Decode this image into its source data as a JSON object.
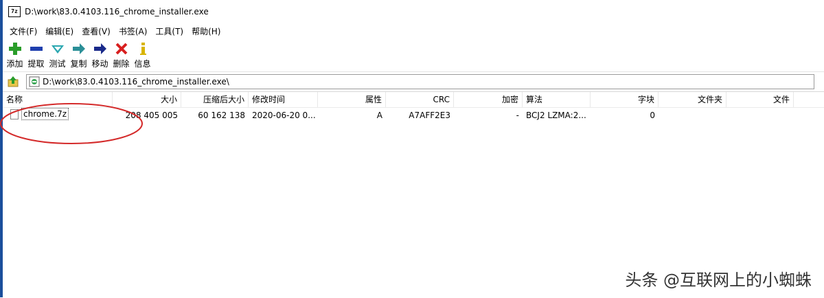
{
  "window": {
    "title": "D:\\work\\83.0.4103.116_chrome_installer.exe",
    "app_icon_text": "7z"
  },
  "menu": [
    "文件(F)",
    "编辑(E)",
    "查看(V)",
    "书签(A)",
    "工具(T)",
    "帮助(H)"
  ],
  "toolbar": {
    "add": "添加",
    "extract": "提取",
    "test": "测试",
    "copy": "复制",
    "move": "移动",
    "delete": "删除",
    "info": "信息"
  },
  "address": {
    "path": "D:\\work\\83.0.4103.116_chrome_installer.exe\\"
  },
  "columns": {
    "name": "名称",
    "size": "大小",
    "packed": "压缩后大小",
    "modified": "修改时间",
    "attributes": "属性",
    "crc": "CRC",
    "encrypted": "加密",
    "method": "算法",
    "block": "字块",
    "folders": "文件夹",
    "files": "文件"
  },
  "rows": [
    {
      "name": "chrome.7z",
      "size": "208 405 005",
      "packed": "60 162 138",
      "modified": "2020-06-20 0...",
      "attributes": "A",
      "crc": "A7AFF2E3",
      "encrypted": "-",
      "method": "BCJ2 LZMA:2...",
      "block": "0",
      "folders": "",
      "files": ""
    }
  ],
  "watermark": "头条 @互联网上的小蜘蛛",
  "colors": {
    "add_green": "#2a9d2a",
    "extract_blue": "#1f3fae",
    "test_teal": "#2aa7b0",
    "copy_teal": "#2b8f97",
    "move_navy": "#1a2a8a",
    "delete_red": "#d81f1f",
    "info_yellow": "#d8b400",
    "annotation_red": "#d42a2a",
    "window_edge": "#1b4f9c"
  }
}
